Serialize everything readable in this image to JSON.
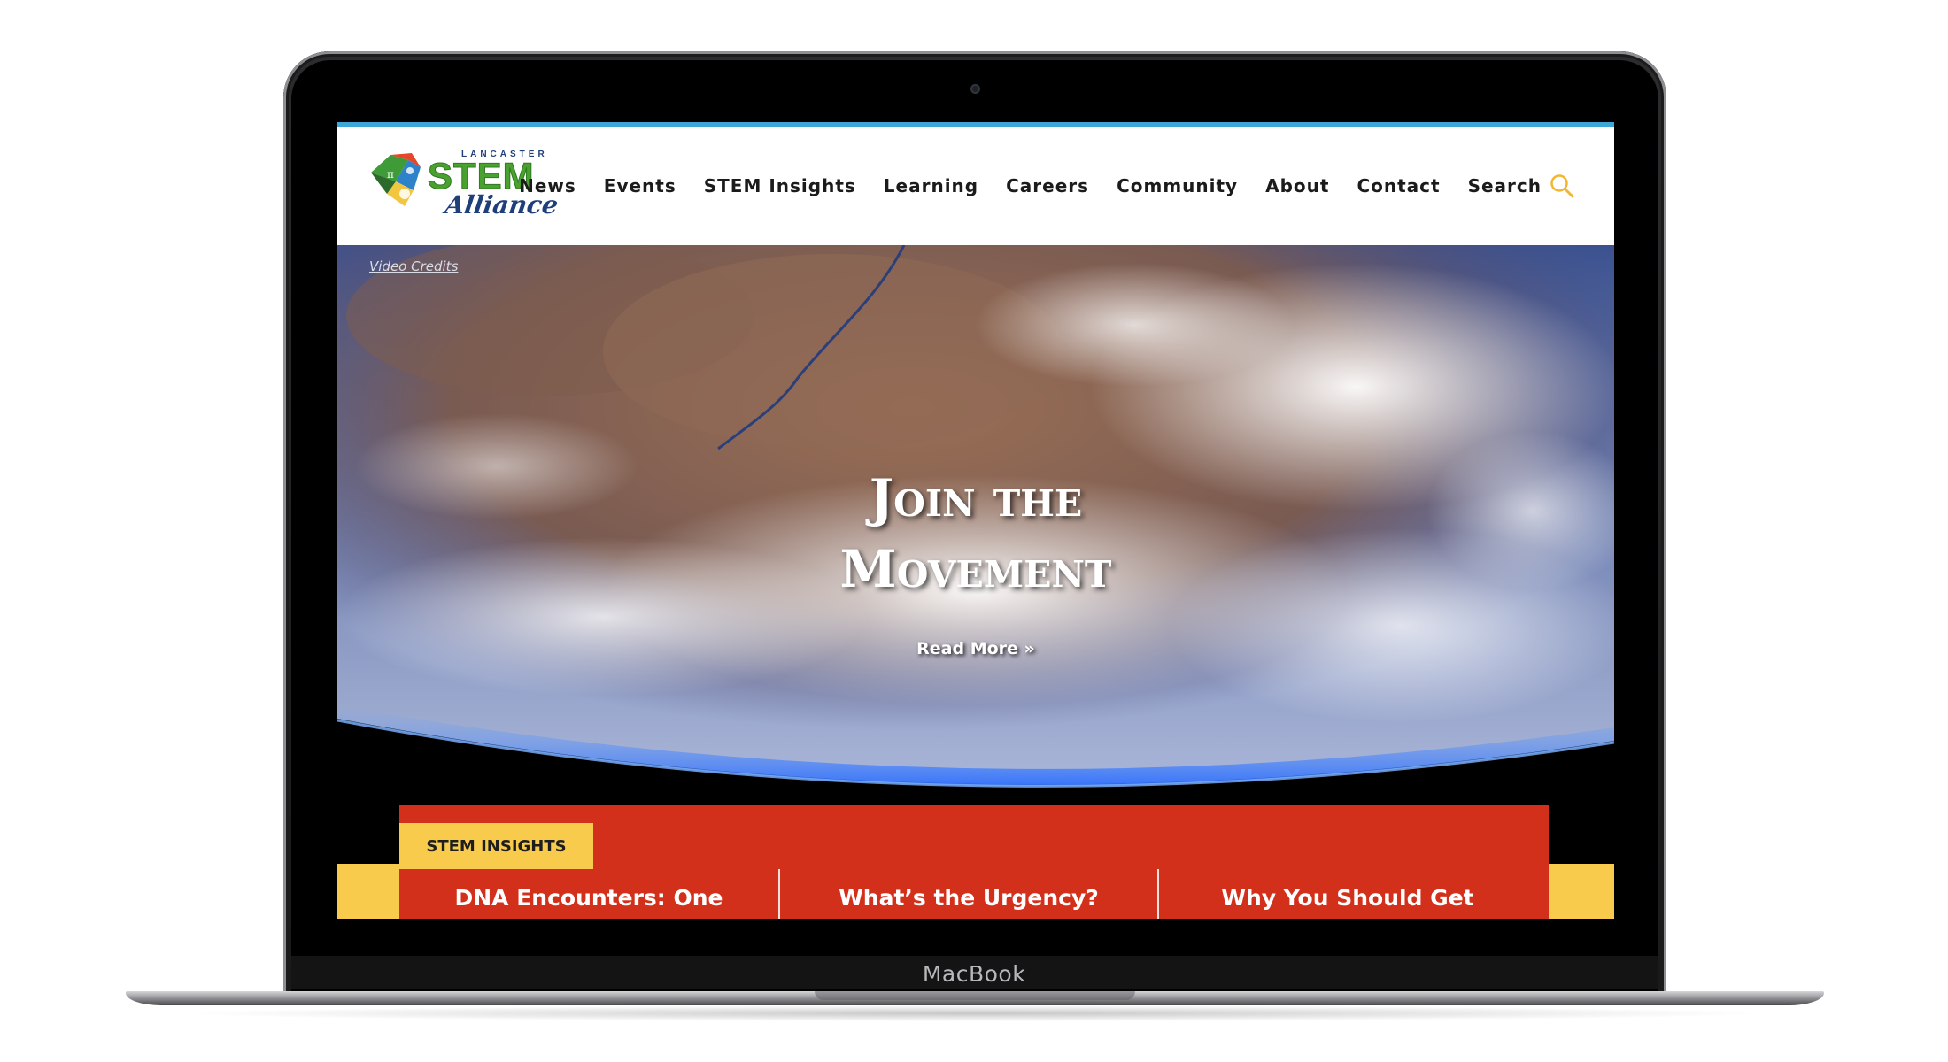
{
  "device": {
    "label": "MacBook"
  },
  "site": {
    "logo": {
      "top_text": "LANCASTER",
      "main_text": "STEM",
      "script_text": "Alliance"
    },
    "nav": [
      "News",
      "Events",
      "STEM Insights",
      "Learning",
      "Careers",
      "Community",
      "About",
      "Contact"
    ],
    "search_label": "Search"
  },
  "hero": {
    "video_credits": "Video Credits",
    "title_line1": "Join the",
    "title_line2": "Movement",
    "read_more": "Read More »"
  },
  "insights": {
    "tag": "STEM INSIGHTS",
    "articles": [
      "DNA Encounters: One",
      "What’s the Urgency?",
      "Why You Should Get"
    ]
  },
  "colors": {
    "accent_blue": "#3da7d8",
    "brand_green": "#4aa12f",
    "brand_navy": "#1f3f7a",
    "insights_red": "#d3301b",
    "insights_yellow": "#f8cb4d"
  },
  "icons": {
    "search": "search-icon",
    "logo_mark": "stem-logo-icon"
  }
}
